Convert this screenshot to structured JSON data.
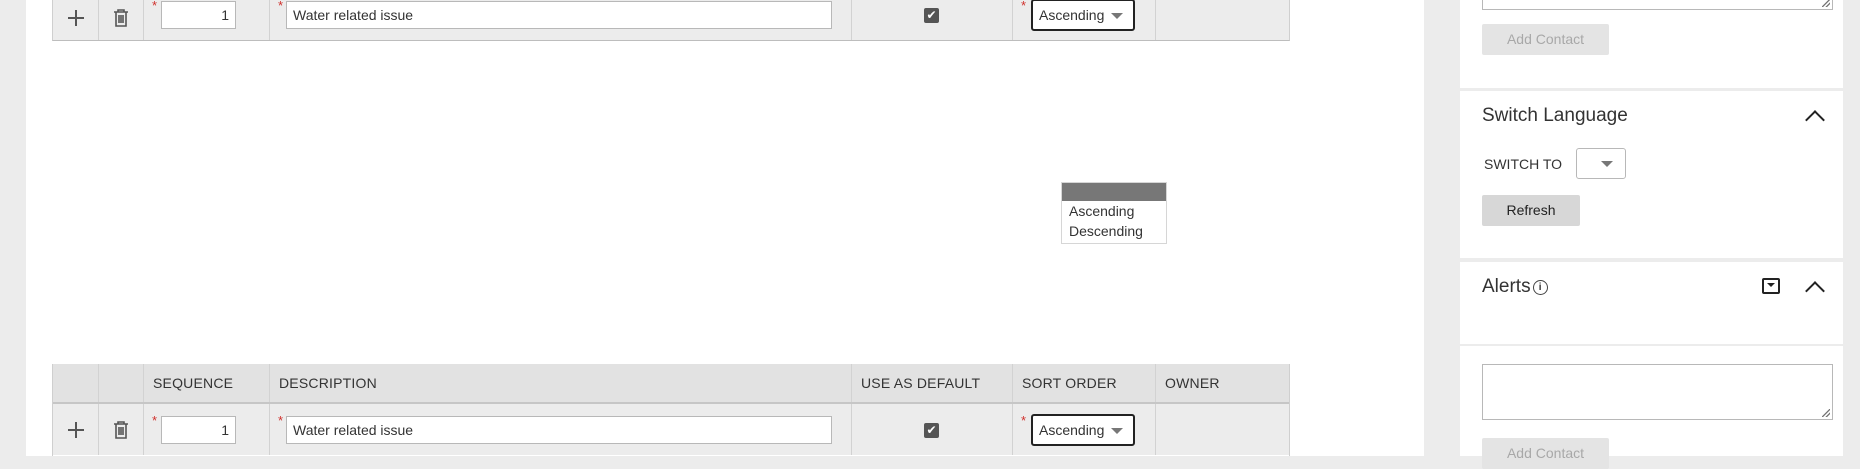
{
  "grid": {
    "headers": {
      "sequence": "SEQUENCE",
      "description": "DESCRIPTION",
      "use_as_default": "USE AS DEFAULT",
      "sort_order": "SORT ORDER",
      "owner": "OWNER"
    },
    "rows": [
      {
        "sequence": "1",
        "description": "Water related issue",
        "use_as_default": true,
        "sort_order": "Ascending"
      },
      {
        "sequence": "1",
        "description": "Water related issue",
        "use_as_default": true,
        "sort_order": "Ascending"
      }
    ],
    "required_marker": "*",
    "checkmark": "✔"
  },
  "sort_order_dropdown": {
    "options": [
      "Ascending",
      "Descending"
    ]
  },
  "sidebar": {
    "contacts": {
      "add_contact_label": "Add Contact"
    },
    "switch_language": {
      "title": "Switch Language",
      "switch_to_label": "SWITCH TO",
      "selected_value": "",
      "refresh_label": "Refresh"
    },
    "alerts": {
      "title": "Alerts",
      "info_glyph": "i"
    },
    "second_contacts": {
      "add_contact_label": "Add Contact"
    }
  }
}
